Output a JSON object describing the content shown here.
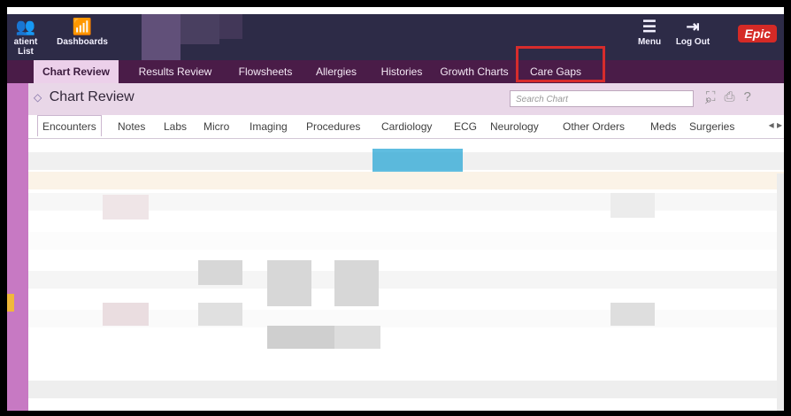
{
  "window": {
    "top_buttons": [
      {
        "label": "atient List",
        "icon": "patient-list-icon"
      },
      {
        "label": "Dashboards",
        "icon": "dashboard-icon"
      },
      {
        "label": "Menu",
        "icon": "menu-icon"
      },
      {
        "label": "Log Out",
        "icon": "logout-icon"
      }
    ],
    "logo_text": "Epic"
  },
  "nav_tabs": [
    {
      "label": "Chart Review",
      "active": true
    },
    {
      "label": "Results Review",
      "active": false
    },
    {
      "label": "Flowsheets",
      "active": false
    },
    {
      "label": "Allergies",
      "active": false
    },
    {
      "label": "Histories",
      "active": false
    },
    {
      "label": "Growth Charts",
      "active": false
    },
    {
      "label": "Care Gaps",
      "active": false
    }
  ],
  "chart_review": {
    "title": "Chart Review",
    "search_placeholder": "Search Chart"
  },
  "subtabs": [
    {
      "label": "Encounters",
      "active": true
    },
    {
      "label": "Notes"
    },
    {
      "label": "Labs"
    },
    {
      "label": "Micro"
    },
    {
      "label": "Imaging"
    },
    {
      "label": "Procedures"
    },
    {
      "label": "Cardiology"
    },
    {
      "label": "ECG"
    },
    {
      "label": "Neurology"
    },
    {
      "label": "Other Orders"
    },
    {
      "label": "Meds"
    },
    {
      "label": "Surgeries"
    }
  ],
  "colors": {
    "topbar": "#2d2b47",
    "navtabs": "#4a1c48",
    "highlight_box": "#d72c2c",
    "accent_cyan": "#29a7d6"
  }
}
